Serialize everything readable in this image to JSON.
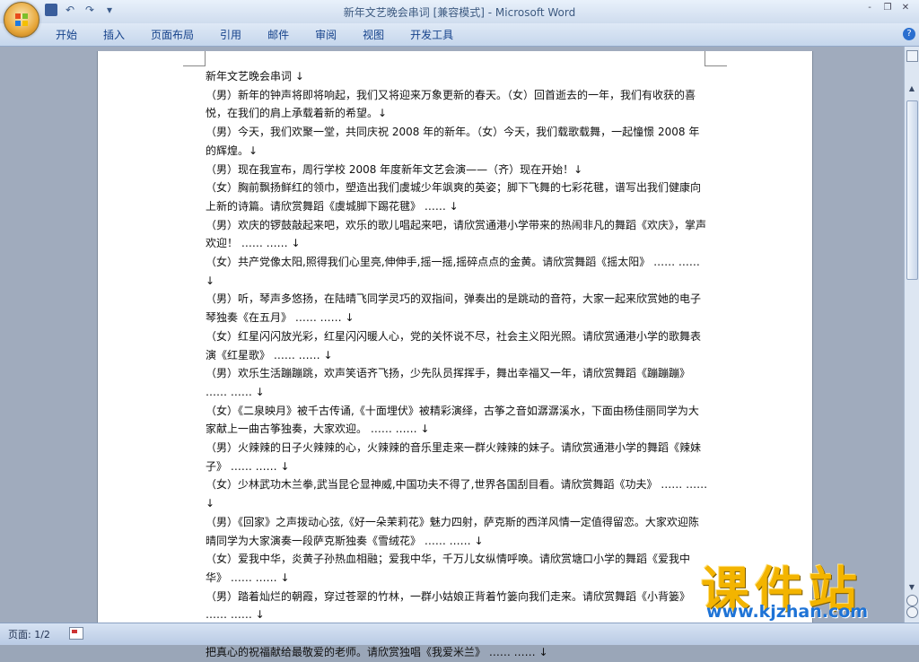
{
  "window": {
    "title": "新年文艺晚会串词 [兼容模式] - Microsoft Word",
    "controls": [
      "-",
      "❐",
      "✕"
    ]
  },
  "quick_access": {
    "undo": "↶",
    "redo": "↷",
    "more": "▾"
  },
  "ribbon": {
    "tabs": [
      "开始",
      "插入",
      "页面布局",
      "引用",
      "邮件",
      "审阅",
      "视图",
      "开发工具"
    ],
    "help": "?"
  },
  "document": {
    "lines": [
      "新年文艺晚会串词 ↓",
      "（男）新年的钟声将即将响起，我们又将迎来万象更新的春天。（女）回首逝去的一年，我们有收获的喜悦，在我们的肩上承载着新的希望。↓",
      "（男）今天，我们欢聚一堂，共同庆祝 2008 年的新年。（女）今天，我们载歌载舞，一起憧憬 2008 年的辉煌。↓",
      "（男）现在我宣布，周行学校 2008 年度新年文艺会演——（齐）现在开始！↓",
      "（女）胸前飘扬鲜红的领巾，塑造出我们虞城少年飒爽的英姿；脚下飞舞的七彩花毽，谱写出我们健康向上新的诗篇。请欣赏舞蹈《虞城脚下踢花毽》 …… ↓",
      "（男）欢庆的锣鼓敲起来吧，欢乐的歌儿唱起来吧，请欣赏通港小学带来的热闹非凡的舞蹈《欢庆》，掌声欢迎！ …… …… ↓",
      "（女）共产党像太阳,照得我们心里亮,伸伸手,摇一摇,摇碎点点的金黄。请欣赏舞蹈《摇太阳》 …… …… ↓",
      "（男）听，琴声多悠扬，在陆晴飞同学灵巧的双指间，弹奏出的是跳动的音符，大家一起来欣赏她的电子琴独奏《在五月》 …… …… ↓",
      "（女）红星闪闪放光彩，红星闪闪暖人心，党的关怀说不尽，社会主义阳光照。请欣赏通港小学的歌舞表演《红星歌》 …… …… ↓",
      "（男）欢乐生活蹦蹦跳，欢声笑语齐飞扬，少先队员挥挥手，舞出幸福又一年，请欣赏舞蹈《蹦蹦蹦》 …… …… ↓",
      "（女）《二泉映月》被千古传诵,《十面埋伏》被精彩演绎，古筝之音如潺潺溪水，下面由杨佳丽同学为大家献上一曲古筝独奏，大家欢迎。 …… …… ↓",
      "（男）火辣辣的日子火辣辣的心，火辣辣的音乐里走来一群火辣辣的妹子。请欣赏通港小学的舞蹈《辣妹子》 …… …… ↓",
      "（女）少林武功木兰拳,武当昆仑显神威,中国功夫不得了,世界各国刮目看。请欣赏舞蹈《功夫》 …… …… ↓",
      "（男）《回家》之声拨动心弦,《好一朵茉莉花》魅力四射，萨克斯的西洋风情一定值得留恋。大家欢迎陈晴同学为大家演奏一段萨克斯独奏《雪绒花》 …… …… ↓",
      "（女）爱我中华，炎黄子孙热血相融；爱我中华，千万儿女纵情呼唤。请欣赏塘口小学的舞蹈《爱我中华》 …… …… ↓",
      "（男）踏着灿烂的朝霞，穿过苍翠的竹林，一群小姑娘正背着竹篓向我们走来。请欣赏舞蹈《小背篓》 …… …… ↓",
      "（女）老师是辛勤的园丁，培育我们绽放花香；老师似呕心沥血的春蚕，为我们吐尽最后一根丝，让我们把真心的祝福献给最敬爱的老师。请欣赏独唱《我爱米兰》 …… …… ↓"
    ]
  },
  "statusbar": {
    "page": "页面: 1/2"
  },
  "watermark": {
    "title": "课件站",
    "url": "www.kjzhan.com"
  }
}
